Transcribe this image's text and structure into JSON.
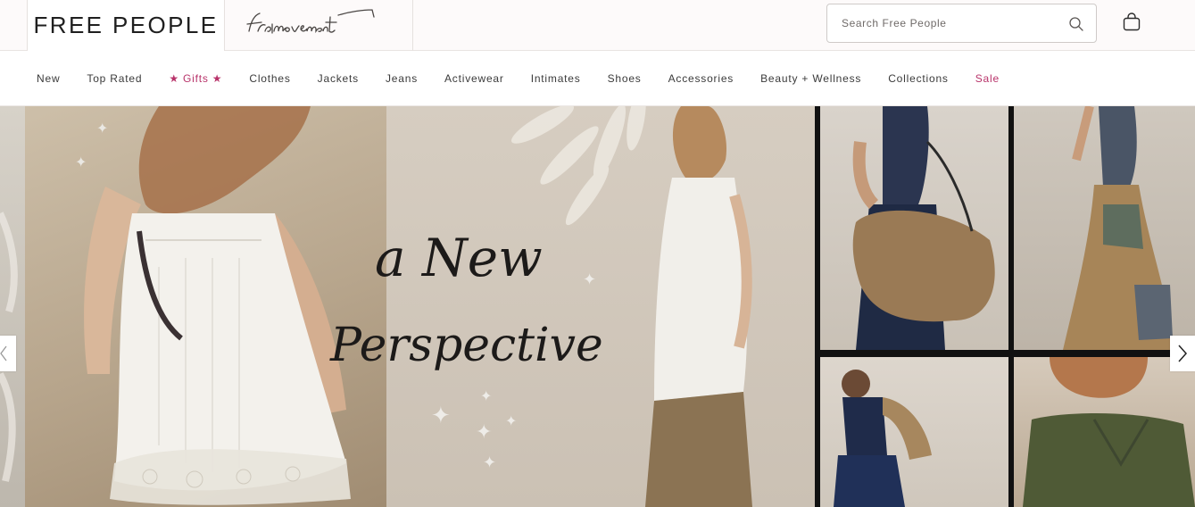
{
  "header": {
    "brand_primary": "FREE PEOPLE",
    "brand_secondary": "fpmovement",
    "search_placeholder": "Search Free People"
  },
  "nav": {
    "items": [
      {
        "label": "New"
      },
      {
        "label": "Top Rated"
      },
      {
        "label": "★ Gifts ★",
        "color": "#b8336a"
      },
      {
        "label": "Clothes"
      },
      {
        "label": "Jackets"
      },
      {
        "label": "Jeans"
      },
      {
        "label": "Activewear"
      },
      {
        "label": "Intimates"
      },
      {
        "label": "Shoes"
      },
      {
        "label": "Accessories"
      },
      {
        "label": "Beauty + Wellness"
      },
      {
        "label": "Collections"
      },
      {
        "label": "Sale",
        "color": "#b8336a"
      }
    ]
  },
  "hero": {
    "headline_line1": "a New",
    "headline_line2": "Perspective",
    "prev_icon": "chevron-left-icon",
    "next_icon": "chevron-right-icon"
  },
  "icons": {
    "search": "search-icon",
    "bag": "shopping-bag-icon"
  },
  "colors": {
    "accent": "#b8336a",
    "header_bg": "#fdfafa",
    "text": "#2b2b2b"
  }
}
